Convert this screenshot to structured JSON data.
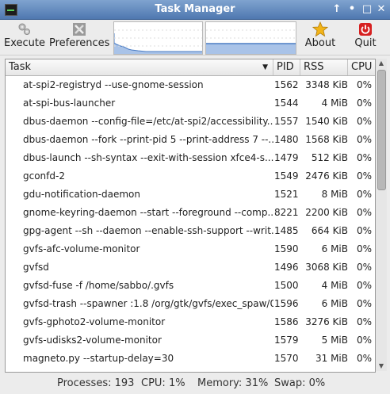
{
  "window": {
    "title": "Task Manager",
    "controls": [
      "↑",
      "•",
      "□",
      "✕"
    ]
  },
  "toolbar": {
    "execute_label": "Execute",
    "preferences_label": "Preferences",
    "about_label": "About",
    "quit_label": "Quit"
  },
  "columns": {
    "task": "Task",
    "pid": "PID",
    "rss": "RSS",
    "cpu": "CPU",
    "sort_indicator": "▼"
  },
  "processes": [
    {
      "task": "at-spi2-registryd --use-gnome-session",
      "pid": "1562",
      "rss": "3348 KiB",
      "cpu": "0%"
    },
    {
      "task": "at-spi-bus-launcher",
      "pid": "1544",
      "rss": "4 MiB",
      "cpu": "0%"
    },
    {
      "task": "dbus-daemon --config-file=/etc/at-spi2/accessibility...",
      "pid": "1557",
      "rss": "1540 KiB",
      "cpu": "0%"
    },
    {
      "task": "dbus-daemon --fork --print-pid 5 --print-address 7 --...",
      "pid": "1480",
      "rss": "1568 KiB",
      "cpu": "0%"
    },
    {
      "task": "dbus-launch --sh-syntax --exit-with-session xfce4-s...",
      "pid": "1479",
      "rss": "512 KiB",
      "cpu": "0%"
    },
    {
      "task": "gconfd-2",
      "pid": "1549",
      "rss": "2476 KiB",
      "cpu": "0%"
    },
    {
      "task": "gdu-notification-daemon",
      "pid": "1521",
      "rss": "8 MiB",
      "cpu": "0%"
    },
    {
      "task": "gnome-keyring-daemon --start --foreground --comp...",
      "pid": "8221",
      "rss": "2200 KiB",
      "cpu": "0%"
    },
    {
      "task": "gpg-agent --sh --daemon --enable-ssh-support --writ...",
      "pid": "1485",
      "rss": "664 KiB",
      "cpu": "0%"
    },
    {
      "task": "gvfs-afc-volume-monitor",
      "pid": "1590",
      "rss": "6 MiB",
      "cpu": "0%"
    },
    {
      "task": "gvfsd",
      "pid": "1496",
      "rss": "3068 KiB",
      "cpu": "0%"
    },
    {
      "task": "gvfsd-fuse -f /home/sabbo/.gvfs",
      "pid": "1500",
      "rss": "4 MiB",
      "cpu": "0%"
    },
    {
      "task": "gvfsd-trash --spawner :1.8 /org/gtk/gvfs/exec_spaw/0",
      "pid": "1596",
      "rss": "6 MiB",
      "cpu": "0%"
    },
    {
      "task": "gvfs-gphoto2-volume-monitor",
      "pid": "1586",
      "rss": "3276 KiB",
      "cpu": "0%"
    },
    {
      "task": "gvfs-udisks2-volume-monitor",
      "pid": "1579",
      "rss": "5 MiB",
      "cpu": "0%"
    },
    {
      "task": "magneto.py --startup-delay=30",
      "pid": "1570",
      "rss": "31 MiB",
      "cpu": "0%"
    }
  ],
  "status": {
    "processes": "Processes: 193",
    "cpu": "CPU: 1%",
    "memory": "Memory: 31%",
    "swap": "Swap: 0%"
  },
  "colors": {
    "titlebar": "#5a82b8",
    "graph_line": "#4a7cc4",
    "graph_fill": "#a9c3e8",
    "quit_red": "#d62020",
    "about_star": "#f2b418"
  },
  "icons": {
    "execute": "gears-icon",
    "preferences": "tools-icon",
    "about": "star-icon",
    "quit": "power-icon"
  }
}
